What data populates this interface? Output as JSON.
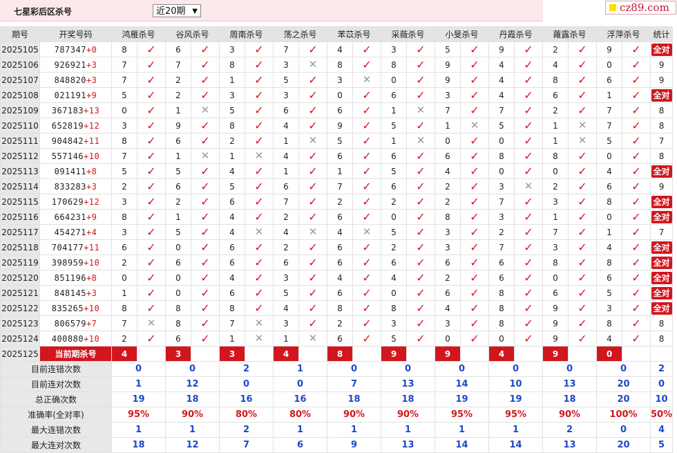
{
  "header": {
    "title": "七星彩后区杀号",
    "select_value": "近20期",
    "brand": "cz89.com"
  },
  "columns": {
    "period": "期号",
    "draw": "开奖号码",
    "experts": [
      "鸿雁杀号",
      "谷风杀号",
      "周南杀号",
      "荡之杀号",
      "苯苡杀号",
      "采薇杀号",
      "小旻杀号",
      "丹霞杀号",
      "蕹露杀号",
      "浮萍杀号"
    ],
    "stat": "统计"
  },
  "rows": [
    {
      "period": "2025105",
      "digits": "787347",
      "plus": "+0",
      "kills": [
        [
          "8",
          1
        ],
        [
          "6",
          1
        ],
        [
          "3",
          1
        ],
        [
          "7",
          1
        ],
        [
          "4",
          1
        ],
        [
          "3",
          1
        ],
        [
          "5",
          1
        ],
        [
          "9",
          1
        ],
        [
          "2",
          1
        ],
        [
          "9",
          1
        ]
      ],
      "stat": "全对"
    },
    {
      "period": "2025106",
      "digits": "926921",
      "plus": "+3",
      "kills": [
        [
          "7",
          1
        ],
        [
          "7",
          1
        ],
        [
          "8",
          1
        ],
        [
          "3",
          0
        ],
        [
          "8",
          1
        ],
        [
          "8",
          1
        ],
        [
          "9",
          1
        ],
        [
          "4",
          1
        ],
        [
          "4",
          1
        ],
        [
          "0",
          1
        ]
      ],
      "stat": "9"
    },
    {
      "period": "2025107",
      "digits": "848820",
      "plus": "+3",
      "kills": [
        [
          "7",
          1
        ],
        [
          "2",
          1
        ],
        [
          "1",
          1
        ],
        [
          "5",
          1
        ],
        [
          "3",
          0
        ],
        [
          "0",
          1
        ],
        [
          "9",
          1
        ],
        [
          "4",
          1
        ],
        [
          "8",
          1
        ],
        [
          "6",
          1
        ]
      ],
      "stat": "9"
    },
    {
      "period": "2025108",
      "digits": "021191",
      "plus": "+9",
      "kills": [
        [
          "5",
          1
        ],
        [
          "2",
          1
        ],
        [
          "3",
          1
        ],
        [
          "3",
          1
        ],
        [
          "0",
          1
        ],
        [
          "6",
          1
        ],
        [
          "3",
          1
        ],
        [
          "4",
          1
        ],
        [
          "6",
          1
        ],
        [
          "1",
          1
        ]
      ],
      "stat": "全对"
    },
    {
      "period": "2025109",
      "digits": "367183",
      "plus": "+13",
      "kills": [
        [
          "0",
          1
        ],
        [
          "1",
          0
        ],
        [
          "5",
          1
        ],
        [
          "6",
          1
        ],
        [
          "6",
          1
        ],
        [
          "1",
          0
        ],
        [
          "7",
          1
        ],
        [
          "7",
          1
        ],
        [
          "2",
          1
        ],
        [
          "7",
          1
        ]
      ],
      "stat": "8"
    },
    {
      "period": "2025110",
      "digits": "652819",
      "plus": "+12",
      "kills": [
        [
          "3",
          1
        ],
        [
          "9",
          1
        ],
        [
          "8",
          1
        ],
        [
          "4",
          1
        ],
        [
          "9",
          1
        ],
        [
          "5",
          1
        ],
        [
          "1",
          0
        ],
        [
          "5",
          1
        ],
        [
          "1",
          0
        ],
        [
          "7",
          1
        ]
      ],
      "stat": "8"
    },
    {
      "period": "2025111",
      "digits": "904842",
      "plus": "+11",
      "kills": [
        [
          "8",
          1
        ],
        [
          "6",
          1
        ],
        [
          "2",
          1
        ],
        [
          "1",
          0
        ],
        [
          "5",
          1
        ],
        [
          "1",
          0
        ],
        [
          "0",
          1
        ],
        [
          "0",
          1
        ],
        [
          "1",
          0
        ],
        [
          "5",
          1
        ]
      ],
      "stat": "7"
    },
    {
      "period": "2025112",
      "digits": "557146",
      "plus": "+10",
      "kills": [
        [
          "7",
          1
        ],
        [
          "1",
          0
        ],
        [
          "1",
          0
        ],
        [
          "4",
          1
        ],
        [
          "6",
          1
        ],
        [
          "6",
          1
        ],
        [
          "6",
          1
        ],
        [
          "8",
          1
        ],
        [
          "8",
          1
        ],
        [
          "0",
          1
        ]
      ],
      "stat": "8"
    },
    {
      "period": "2025113",
      "digits": "091411",
      "plus": "+8",
      "kills": [
        [
          "5",
          1
        ],
        [
          "5",
          1
        ],
        [
          "4",
          1
        ],
        [
          "1",
          1
        ],
        [
          "1",
          1
        ],
        [
          "5",
          1
        ],
        [
          "4",
          1
        ],
        [
          "0",
          1
        ],
        [
          "0",
          1
        ],
        [
          "4",
          1
        ]
      ],
      "stat": "全对"
    },
    {
      "period": "2025114",
      "digits": "833283",
      "plus": "+3",
      "kills": [
        [
          "2",
          1
        ],
        [
          "6",
          1
        ],
        [
          "5",
          1
        ],
        [
          "6",
          1
        ],
        [
          "7",
          1
        ],
        [
          "6",
          1
        ],
        [
          "2",
          1
        ],
        [
          "3",
          0
        ],
        [
          "2",
          1
        ],
        [
          "6",
          1
        ]
      ],
      "stat": "9"
    },
    {
      "period": "2025115",
      "digits": "170629",
      "plus": "+12",
      "kills": [
        [
          "3",
          1
        ],
        [
          "2",
          1
        ],
        [
          "6",
          1
        ],
        [
          "7",
          1
        ],
        [
          "2",
          1
        ],
        [
          "2",
          1
        ],
        [
          "2",
          1
        ],
        [
          "7",
          1
        ],
        [
          "3",
          1
        ],
        [
          "8",
          1
        ]
      ],
      "stat": "全对"
    },
    {
      "period": "2025116",
      "digits": "664231",
      "plus": "+9",
      "kills": [
        [
          "8",
          1
        ],
        [
          "1",
          1
        ],
        [
          "4",
          1
        ],
        [
          "2",
          1
        ],
        [
          "6",
          1
        ],
        [
          "0",
          1
        ],
        [
          "8",
          1
        ],
        [
          "3",
          1
        ],
        [
          "1",
          1
        ],
        [
          "0",
          1
        ]
      ],
      "stat": "全对"
    },
    {
      "period": "2025117",
      "digits": "454271",
      "plus": "+4",
      "kills": [
        [
          "3",
          1
        ],
        [
          "5",
          1
        ],
        [
          "4",
          0
        ],
        [
          "4",
          0
        ],
        [
          "4",
          0
        ],
        [
          "5",
          1
        ],
        [
          "3",
          1
        ],
        [
          "2",
          1
        ],
        [
          "7",
          1
        ],
        [
          "1",
          1
        ]
      ],
      "stat": "7"
    },
    {
      "period": "2025118",
      "digits": "704177",
      "plus": "+11",
      "kills": [
        [
          "6",
          1
        ],
        [
          "0",
          1
        ],
        [
          "6",
          1
        ],
        [
          "2",
          1
        ],
        [
          "6",
          1
        ],
        [
          "2",
          1
        ],
        [
          "3",
          1
        ],
        [
          "7",
          1
        ],
        [
          "3",
          1
        ],
        [
          "4",
          1
        ]
      ],
      "stat": "全对"
    },
    {
      "period": "2025119",
      "digits": "398959",
      "plus": "+10",
      "kills": [
        [
          "2",
          1
        ],
        [
          "6",
          1
        ],
        [
          "6",
          1
        ],
        [
          "6",
          1
        ],
        [
          "6",
          1
        ],
        [
          "6",
          1
        ],
        [
          "6",
          1
        ],
        [
          "6",
          1
        ],
        [
          "8",
          1
        ],
        [
          "8",
          1
        ]
      ],
      "stat": "全对"
    },
    {
      "period": "2025120",
      "digits": "851196",
      "plus": "+8",
      "kills": [
        [
          "0",
          1
        ],
        [
          "0",
          1
        ],
        [
          "4",
          1
        ],
        [
          "3",
          1
        ],
        [
          "4",
          1
        ],
        [
          "4",
          1
        ],
        [
          "2",
          1
        ],
        [
          "6",
          1
        ],
        [
          "0",
          1
        ],
        [
          "6",
          1
        ]
      ],
      "stat": "全对"
    },
    {
      "period": "2025121",
      "digits": "848145",
      "plus": "+3",
      "kills": [
        [
          "1",
          1
        ],
        [
          "0",
          1
        ],
        [
          "6",
          1
        ],
        [
          "5",
          1
        ],
        [
          "6",
          1
        ],
        [
          "0",
          1
        ],
        [
          "6",
          1
        ],
        [
          "8",
          1
        ],
        [
          "6",
          1
        ],
        [
          "5",
          1
        ]
      ],
      "stat": "全对"
    },
    {
      "period": "2025122",
      "digits": "835265",
      "plus": "+10",
      "kills": [
        [
          "8",
          1
        ],
        [
          "8",
          1
        ],
        [
          "8",
          1
        ],
        [
          "4",
          1
        ],
        [
          "8",
          1
        ],
        [
          "8",
          1
        ],
        [
          "4",
          1
        ],
        [
          "8",
          1
        ],
        [
          "9",
          1
        ],
        [
          "3",
          1
        ]
      ],
      "stat": "全对"
    },
    {
      "period": "2025123",
      "digits": "806579",
      "plus": "+7",
      "kills": [
        [
          "7",
          0
        ],
        [
          "8",
          1
        ],
        [
          "7",
          0
        ],
        [
          "3",
          1
        ],
        [
          "2",
          1
        ],
        [
          "3",
          1
        ],
        [
          "3",
          1
        ],
        [
          "8",
          1
        ],
        [
          "9",
          1
        ],
        [
          "8",
          1
        ]
      ],
      "stat": "8"
    },
    {
      "period": "2025124",
      "digits": "400880",
      "plus": "+10",
      "kills": [
        [
          "2",
          1
        ],
        [
          "6",
          1
        ],
        [
          "1",
          0
        ],
        [
          "1",
          0
        ],
        [
          "6",
          1
        ],
        [
          "5",
          1
        ],
        [
          "0",
          1
        ],
        [
          "0",
          1
        ],
        [
          "9",
          1
        ],
        [
          "4",
          1
        ]
      ],
      "stat": "8"
    }
  ],
  "current": {
    "period": "2025125",
    "label": "当前期杀号",
    "kills": [
      "4",
      "3",
      "3",
      "4",
      "8",
      "9",
      "9",
      "4",
      "9",
      "0"
    ]
  },
  "stats": [
    {
      "label": "目前连错次数",
      "values": [
        "0",
        "0",
        "2",
        "1",
        "0",
        "0",
        "0",
        "0",
        "0",
        "0"
      ],
      "stat": "2",
      "red": false
    },
    {
      "label": "目前连对次数",
      "values": [
        "1",
        "12",
        "0",
        "0",
        "7",
        "13",
        "14",
        "10",
        "13",
        "20"
      ],
      "stat": "0",
      "red": false
    },
    {
      "label": "总正确次数",
      "values": [
        "19",
        "18",
        "16",
        "16",
        "18",
        "18",
        "19",
        "19",
        "18",
        "20"
      ],
      "stat": "10",
      "red": false
    },
    {
      "label": "准确率(全对率)",
      "values": [
        "95%",
        "90%",
        "80%",
        "80%",
        "90%",
        "90%",
        "95%",
        "95%",
        "90%",
        "100%"
      ],
      "stat": "50%",
      "red": true
    },
    {
      "label": "最大连错次数",
      "values": [
        "1",
        "1",
        "2",
        "1",
        "1",
        "1",
        "1",
        "1",
        "2",
        "0"
      ],
      "stat": "4",
      "red": false
    },
    {
      "label": "最大连对次数",
      "values": [
        "18",
        "12",
        "7",
        "6",
        "9",
        "13",
        "14",
        "14",
        "13",
        "20"
      ],
      "stat": "5",
      "red": false
    }
  ],
  "colors": {
    "accent": "#d2161e",
    "stat_blue": "#1b4ac8",
    "header_bg": "#e4e4e4",
    "title_bg": "#fde8ec"
  },
  "icons": {
    "correct": "check-icon",
    "wrong": "cross-icon"
  }
}
